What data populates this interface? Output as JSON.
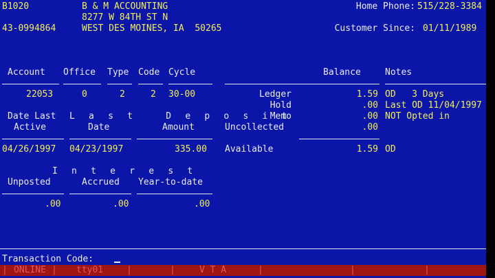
{
  "header": {
    "code": "B1020",
    "customer_name": "B & M ACCOUNTING",
    "address_line1": "8277 W 84TH ST N",
    "id_number": "43-0994864",
    "address_line2": "WEST DES MOINES, IA  50265",
    "home_phone_label": "Home Phone:",
    "home_phone_value": "515/228-3384",
    "customer_since_label": "Customer Since:",
    "customer_since_value": "01/11/1989"
  },
  "account_table": {
    "headers": {
      "account": "Account",
      "office": "Office",
      "type": "Type",
      "code": "Code",
      "cycle": "Cycle"
    },
    "row": {
      "account": "22053",
      "office": "0",
      "type": "2",
      "code": "2",
      "cycle": "30-00"
    }
  },
  "date_last_active": {
    "label_line1": "Date Last",
    "label_line2": "Active",
    "value": "04/26/1997"
  },
  "last_deposit": {
    "label_line1": "L a s t   D e p o s i t",
    "date_label": "Date",
    "amount_label": "Amount",
    "date_value": "04/23/1997",
    "amount_value": "335.00"
  },
  "interest": {
    "group_label": "I n t e r e s t",
    "headers": {
      "unposted": "Unposted",
      "accrued": "Accrued",
      "year_to_date": "Year-to-date"
    },
    "values": {
      "unposted": ".00",
      "accrued": ".00",
      "year_to_date": ".00"
    }
  },
  "balances": {
    "balance_header": "Balance",
    "notes_header": "Notes",
    "rows": [
      {
        "label": "Ledger",
        "amount": "1.59",
        "note": "OD   3 Days"
      },
      {
        "label": "Hold",
        "amount": ".00",
        "note": "Last OD 11/04/1997"
      },
      {
        "label": "Memo",
        "amount": ".00",
        "note": "NOT Opted in"
      },
      {
        "label": "Uncollected",
        "amount": ".00",
        "note": ""
      }
    ],
    "available": {
      "label": "Available",
      "amount": "1.59",
      "note": "OD"
    }
  },
  "transaction": {
    "label": "Transaction Code:",
    "value": ""
  },
  "status_bar": {
    "items": [
      "ONLINE",
      "tty01",
      "V T A"
    ]
  },
  "colors": {
    "background": "#0b16a8",
    "data_text": "#f2ef5a",
    "label_text": "#e9ebf4",
    "status_bar": "#a01414"
  }
}
